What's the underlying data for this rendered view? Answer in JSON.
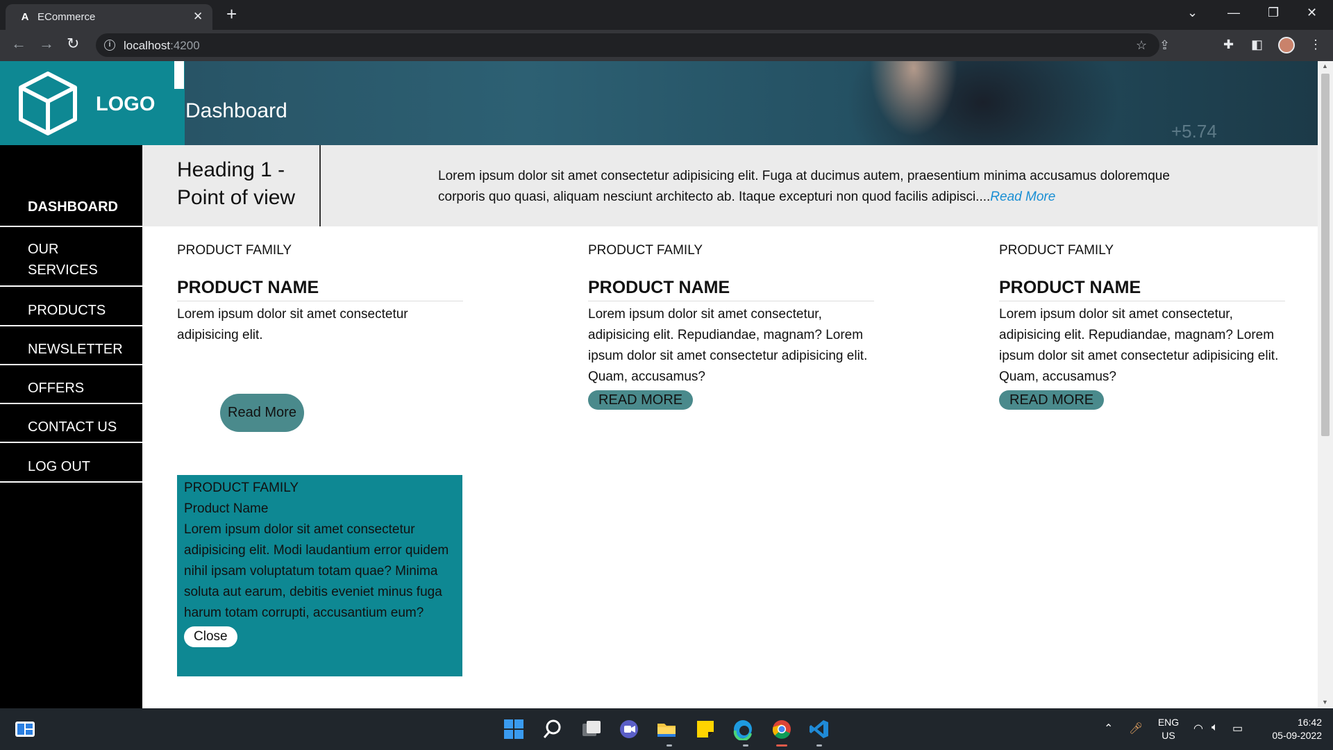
{
  "browser": {
    "tab_title": "ECommerce",
    "tab_favicon": "A",
    "url_host": "localhost",
    "url_port": ":4200"
  },
  "header": {
    "logo_text": "LOGO",
    "title": "Dashboard",
    "hero_overlay_text": "+5.74"
  },
  "sidebar": {
    "items": [
      {
        "label": "DASHBOARD",
        "active": true
      },
      {
        "label": "OUR SERVICES",
        "active": false
      },
      {
        "label": "PRODUCTS",
        "active": false
      },
      {
        "label": "NEWSLETTER",
        "active": false
      },
      {
        "label": "OFFERS",
        "active": false
      },
      {
        "label": "CONTACT US",
        "active": false
      },
      {
        "label": "LOG OUT",
        "active": false
      }
    ]
  },
  "heading_band": {
    "title": "Heading 1 - Point of view",
    "text": "Lorem ipsum dolor sit amet consectetur adipisicing elit. Fuga at ducimus autem, praesentium minima accusamus doloremque corporis quo quasi, aliquam nesciunt architecto ab. Itaque excepturi non quod facilis adipisci....",
    "read_more": "Read More"
  },
  "cards": [
    {
      "family": "PRODUCT FAMILY",
      "name": "PRODUCT NAME",
      "description": "Lorem ipsum dolor sit amet consectetur adipisicing elit.",
      "button": "Read More"
    },
    {
      "family": "PRODUCT FAMILY",
      "name": "PRODUCT NAME",
      "description": "Lorem ipsum dolor sit amet consectetur, adipisicing elit. Repudiandae, magnam? Lorem ipsum dolor sit amet consectetur adipisicing elit. Quam, accusamus?",
      "button": "READ MORE"
    },
    {
      "family": "PRODUCT FAMILY",
      "name": "PRODUCT NAME",
      "description": "Lorem ipsum dolor sit amet consectetur, adipisicing elit. Repudiandae, magnam? Lorem ipsum dolor sit amet consectetur adipisicing elit. Quam, accusamus?",
      "button": "READ MORE"
    }
  ],
  "popup": {
    "family": "PRODUCT FAMILY",
    "name": "Product Name",
    "description": "Lorem ipsum dolor sit amet consectetur adipisicing elit. Modi laudantium error quidem nihil ipsam voluptatum totam quae? Minima soluta aut earum, debitis eveniet minus fuga harum totam corrupti, accusantium eum?",
    "close": "Close"
  },
  "taskbar": {
    "language": "ENG",
    "region": "US",
    "time": "16:42",
    "date": "05-09-2022"
  },
  "colors": {
    "brand_teal": "#0e8893",
    "button_teal": "#4a8a8c",
    "sidebar_bg": "#000000",
    "link_blue": "#1a8fd4"
  }
}
